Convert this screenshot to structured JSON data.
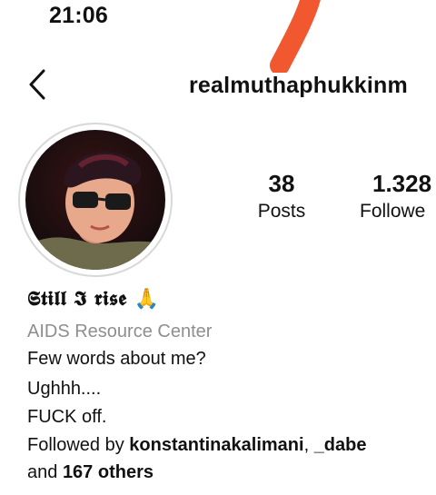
{
  "status_bar": {
    "time": "21:06"
  },
  "header": {
    "username": "realmuthaphukkinm"
  },
  "stats": {
    "posts_count": "38",
    "posts_label": "Posts",
    "followers_count": "1.328",
    "followers_label": "Followe"
  },
  "profile": {
    "display_name": "𝕾𝖙𝖎𝖑𝖑 𝕴 𝖗𝖎𝖘𝖊 🙏",
    "category": "AIDS Resource Center",
    "bio": [
      "Few words about me?",
      "Ughhh....",
      "FUCK off."
    ]
  },
  "followed_by": {
    "prefix": "Followed by ",
    "user1": "konstantinakalimani",
    "separator": ", ",
    "user2": "_dabe",
    "and_text": "and ",
    "others": "167 others"
  },
  "colors": {
    "accent_mark": "#f04a1e",
    "secondary_text": "#8e8e8e"
  },
  "icons": {
    "back": "chevron-left-icon"
  }
}
